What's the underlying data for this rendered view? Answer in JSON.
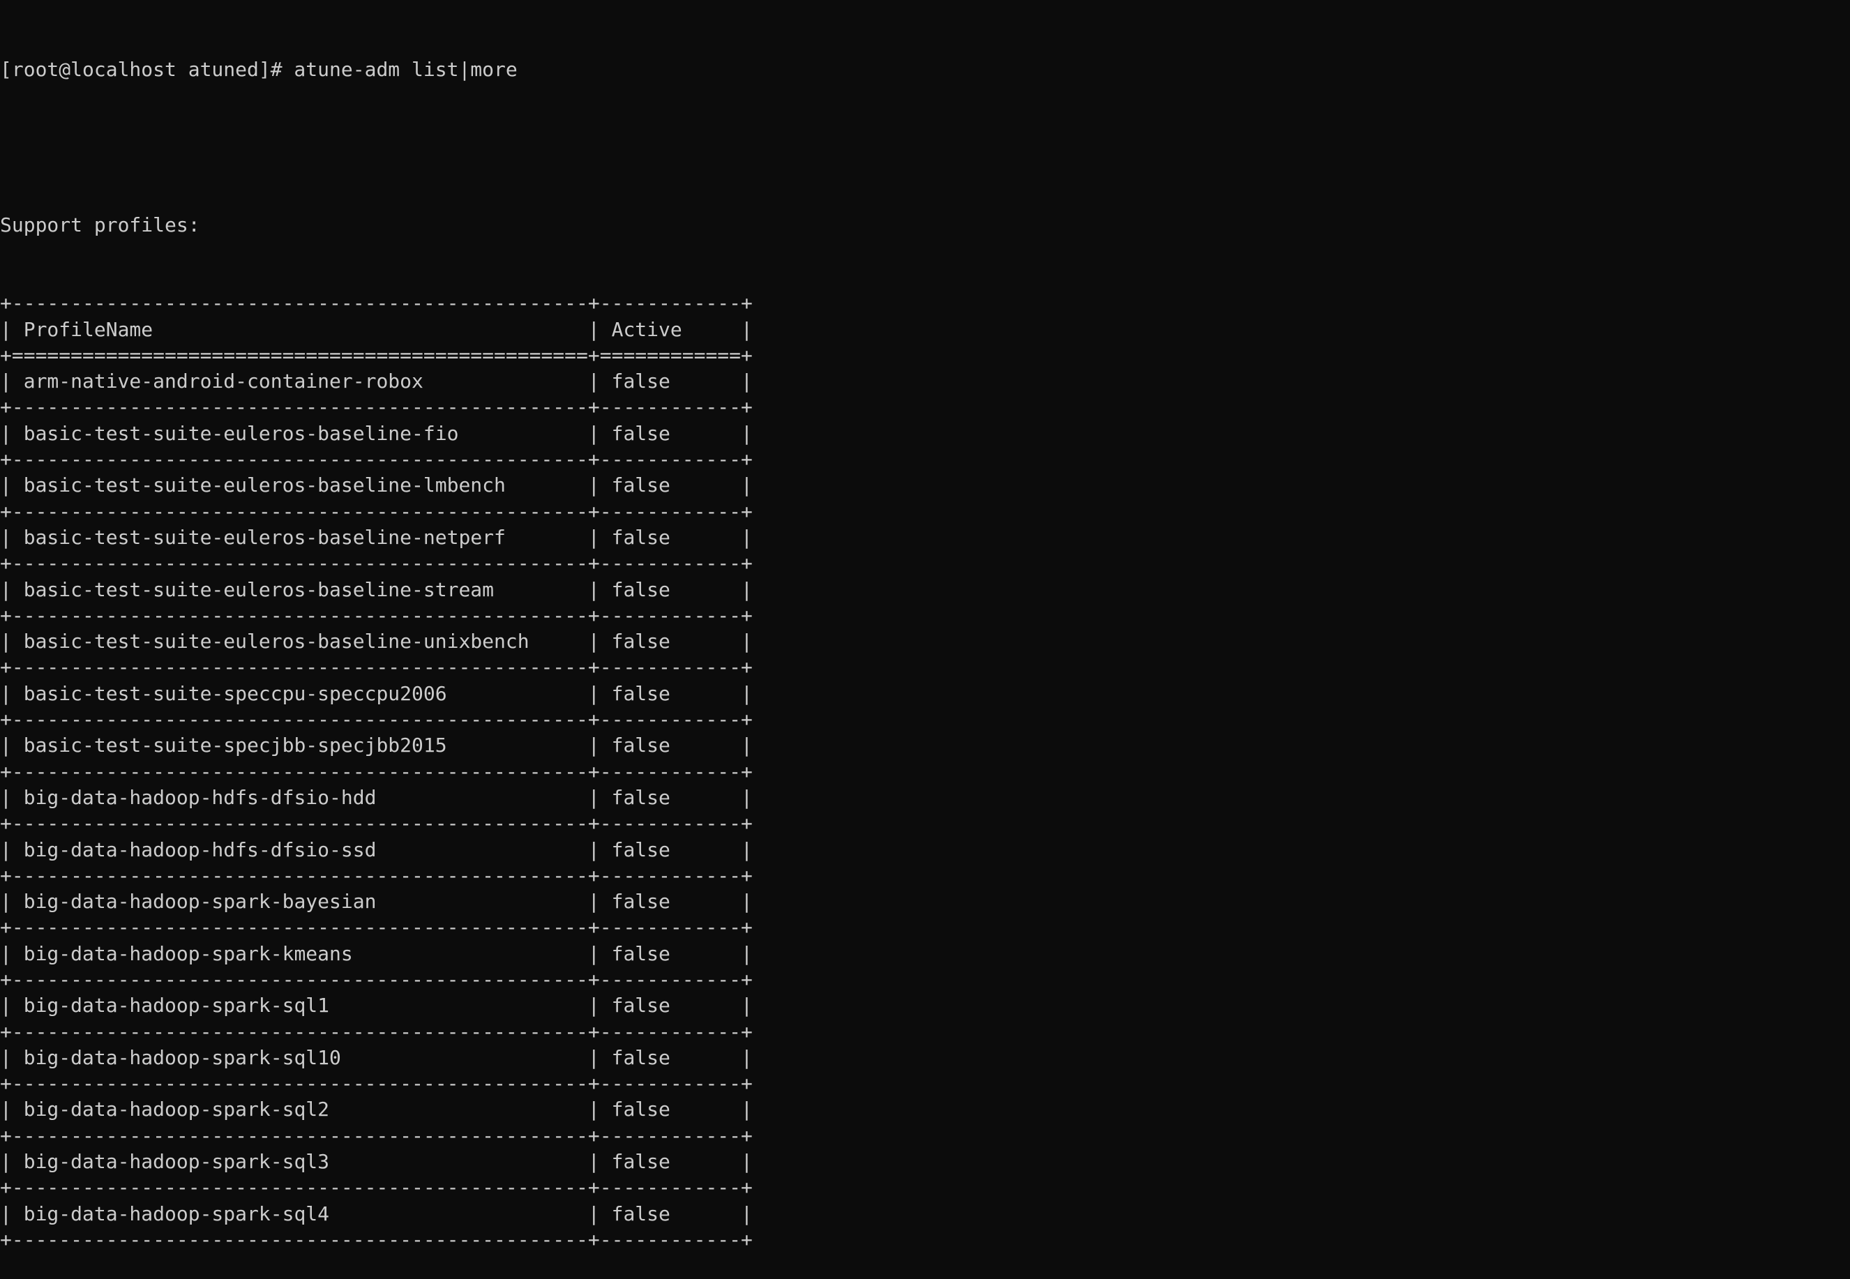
{
  "terminal": {
    "prompt": "[root@localhost atuned]# atune-adm list|more",
    "section_title": "Support profiles:",
    "table": {
      "headers": [
        "ProfileName",
        "Active"
      ],
      "rows": [
        {
          "name": "arm-native-android-container-robox",
          "active": "false"
        },
        {
          "name": "basic-test-suite-euleros-baseline-fio",
          "active": "false"
        },
        {
          "name": "basic-test-suite-euleros-baseline-lmbench",
          "active": "false"
        },
        {
          "name": "basic-test-suite-euleros-baseline-netperf",
          "active": "false"
        },
        {
          "name": "basic-test-suite-euleros-baseline-stream",
          "active": "false"
        },
        {
          "name": "basic-test-suite-euleros-baseline-unixbench",
          "active": "false"
        },
        {
          "name": "basic-test-suite-speccpu-speccpu2006",
          "active": "false"
        },
        {
          "name": "basic-test-suite-specjbb-specjbb2015",
          "active": "false"
        },
        {
          "name": "big-data-hadoop-hdfs-dfsio-hdd",
          "active": "false"
        },
        {
          "name": "big-data-hadoop-hdfs-dfsio-ssd",
          "active": "false"
        },
        {
          "name": "big-data-hadoop-spark-bayesian",
          "active": "false"
        },
        {
          "name": "big-data-hadoop-spark-kmeans",
          "active": "false"
        },
        {
          "name": "big-data-hadoop-spark-sql1",
          "active": "false"
        },
        {
          "name": "big-data-hadoop-spark-sql10",
          "active": "false"
        },
        {
          "name": "big-data-hadoop-spark-sql2",
          "active": "false"
        },
        {
          "name": "big-data-hadoop-spark-sql3",
          "active": "false"
        },
        {
          "name": "big-data-hadoop-spark-sql4",
          "active": "false"
        }
      ]
    },
    "colors": {
      "background": "#0c0c0c",
      "foreground": "#cccccc"
    }
  }
}
